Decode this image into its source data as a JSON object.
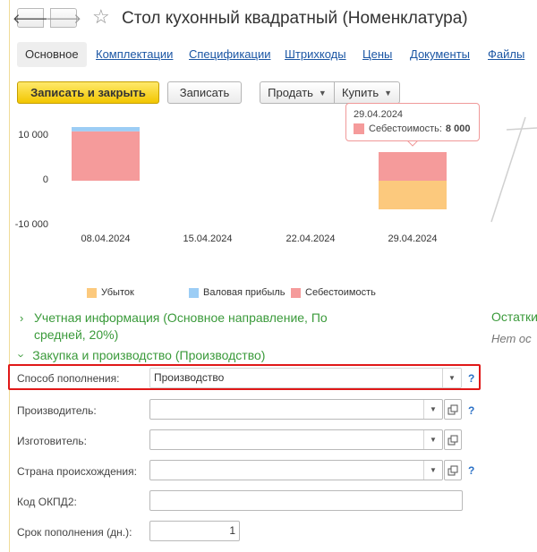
{
  "window": {
    "title": "Стол кухонный квадратный (Номенклатура)",
    "back_glyph": "🡐",
    "forward_glyph": "🡒",
    "star_glyph": "☆"
  },
  "tabs": [
    {
      "label": "Основное",
      "active": true
    },
    {
      "label": "Комплектации"
    },
    {
      "label": "Спецификации"
    },
    {
      "label": "Штрихкоды"
    },
    {
      "label": "Цены"
    },
    {
      "label": "Документы"
    },
    {
      "label": "Файлы"
    }
  ],
  "toolbar": {
    "save_close_label": "Записать и закрыть",
    "save_label": "Записать",
    "sell_label": "Продать",
    "buy_label": "Купить"
  },
  "chart_data": {
    "type": "bar",
    "stacked": true,
    "categories": [
      "08.04.2024",
      "15.04.2024",
      "22.04.2024",
      "29.04.2024"
    ],
    "series": [
      {
        "name": "Убыток",
        "color": "#fcc97d",
        "values": [
          0,
          0,
          0,
          -8000
        ]
      },
      {
        "name": "Валовая прибыль",
        "color": "#9ccdf5",
        "values": [
          1200,
          0,
          0,
          0
        ]
      },
      {
        "name": "Себестоимость",
        "color": "#f59b9b",
        "values": [
          13800,
          0,
          0,
          8000
        ]
      }
    ],
    "yticks": [
      "10 000",
      "0",
      "-10 000"
    ],
    "ylim": [
      -10000,
      16000
    ],
    "legend": "bottom",
    "tooltip": {
      "date": "29.04.2024",
      "series": "Себестоимость:",
      "value": "8 000"
    }
  },
  "groups": {
    "accounting": "Учетная информация (Основное направление, По средней, 20%)",
    "purchase": "Закупка и производство (Производство)",
    "stock": "Остатки",
    "stock_note": "Нет ос"
  },
  "form": {
    "replenishment_method": {
      "label": "Способ пополнения:",
      "value": "Производство"
    },
    "producer": {
      "label": "Производитель:",
      "value": ""
    },
    "manufacturer": {
      "label": "Изготовитель:",
      "value": ""
    },
    "country": {
      "label": "Страна происхождения:",
      "value": ""
    },
    "okpd2": {
      "label": "Код ОКПД2:",
      "value": ""
    },
    "lead_time": {
      "label": "Срок пополнения (дн.):",
      "value": "1"
    },
    "help_glyph": "?"
  }
}
